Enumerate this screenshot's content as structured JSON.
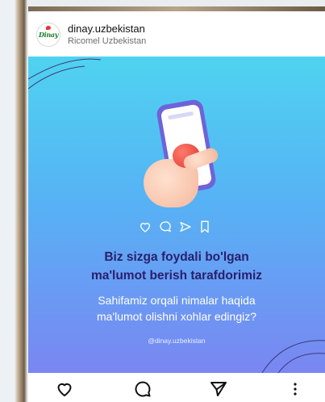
{
  "header": {
    "avatar_text": "Dinay",
    "username": "dinay.uzbekistan",
    "subtitle": "Ricomel Uzbekistan"
  },
  "post": {
    "headline_line1": "Biz sizga foydali bo'lgan",
    "headline_line2": "ma'lumot berish tarafdorimiz",
    "body_line1": "Sahifamiz orqali nimalar haqida",
    "body_line2": "ma'lumot olishni xohlar edingiz?",
    "handle": "@dinay.uzbekistan",
    "icons": [
      "heart-outline-icon",
      "comment-icon",
      "send-icon",
      "bookmark-icon"
    ]
  },
  "actions": {
    "like_icon": "heart-icon",
    "comment_icon": "comment-icon",
    "share_icon": "send-icon",
    "more_icon": "more-vertical-icon"
  },
  "colors": {
    "post_gradient_top": "#4fd3f0",
    "post_gradient_bottom": "#7a86f2",
    "headline": "#2a1f6b",
    "phone": "#6e63d8"
  }
}
